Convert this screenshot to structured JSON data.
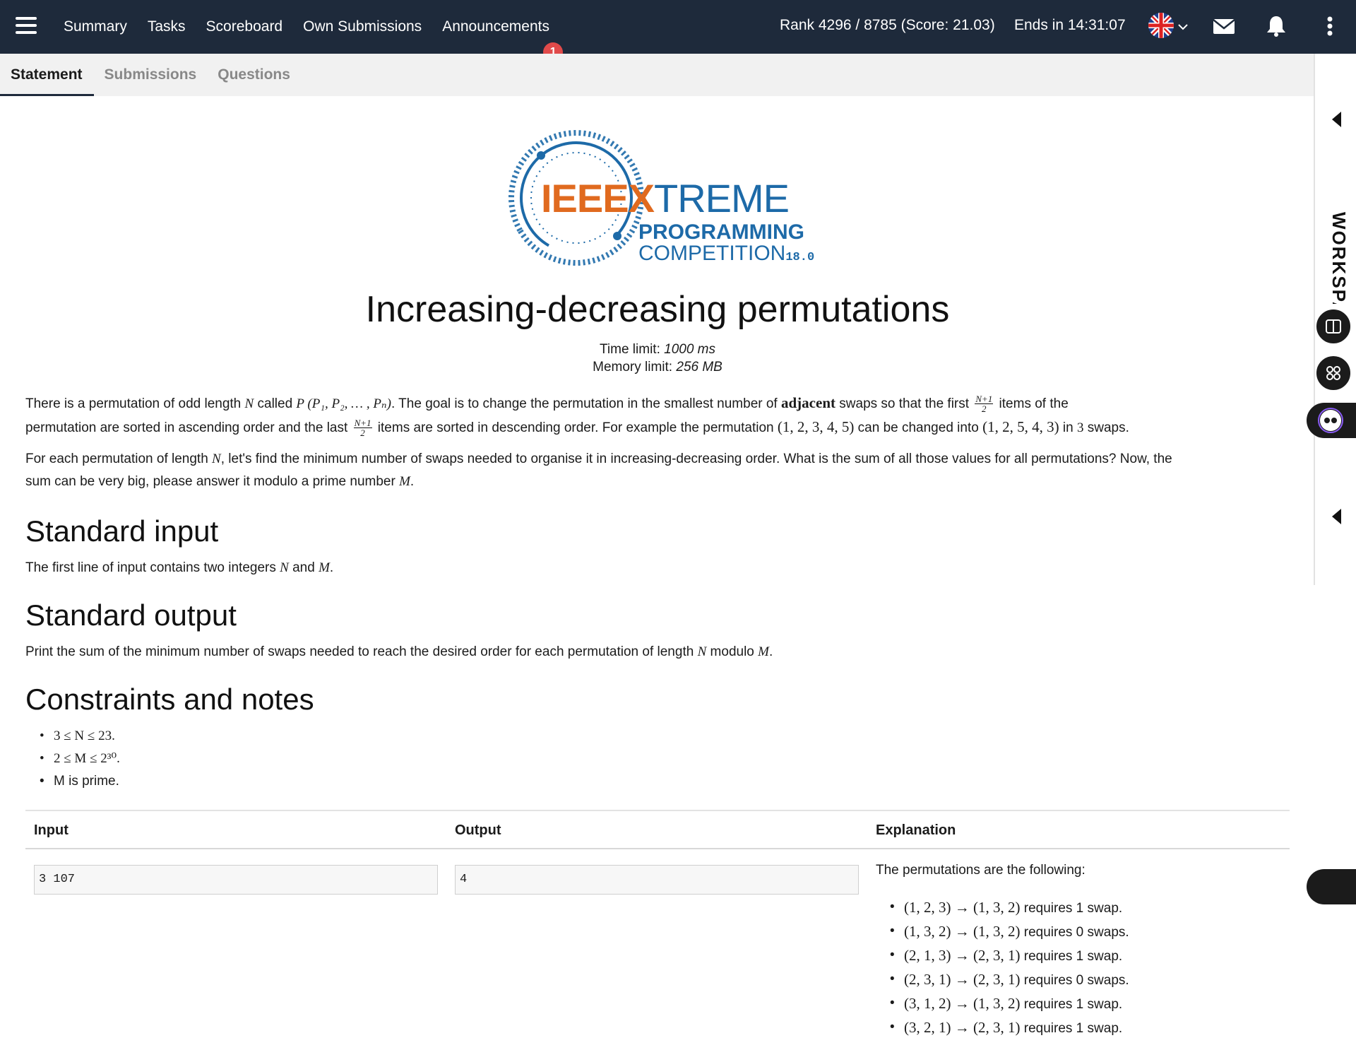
{
  "nav": {
    "items": [
      "Summary",
      "Tasks",
      "Scoreboard",
      "Own Submissions",
      "Announcements"
    ],
    "announcements_badge": "1",
    "rank": "Rank 4296 / 8785 (Score: 21.03)",
    "ends": "Ends in 14:31:07"
  },
  "tabs": [
    "Statement",
    "Submissions",
    "Questions"
  ],
  "sidebar": {
    "workspace_label": "WORKSPA"
  },
  "logo": {
    "ieee": "IEEE",
    "x": "X",
    "treme": "TREME",
    "programming": "PROGRAMMING",
    "competition": "COMPETITION",
    "version": "18.0"
  },
  "problem": {
    "title": "Increasing-decreasing permutations",
    "time_limit_label": "Time limit: ",
    "time_limit": "1000 ms",
    "memory_limit_label": "Memory limit: ",
    "memory_limit": "256 MB",
    "p1_a": "There is a permutation of odd length ",
    "p1_N": "N",
    "p1_b": " called ",
    "p1_P": "P (P₁, P₂, … , Pₙ)",
    "p1_c": ". The goal is to change the permutation in the smallest number of ",
    "p1_adjacent": "adjacent",
    "p1_d": " swaps so that the first ",
    "p1_e": " items of the",
    "p1_f": "permutation are sorted in ascending order and the last ",
    "p1_g": " items are sorted in descending order. For example the permutation ",
    "p1_perm1": "(1, 2, 3, 4, 5)",
    "p1_h": " can be changed into ",
    "p1_perm2": "(1, 2, 5, 4, 3)",
    "p1_i": " in ",
    "p1_three": "3",
    "p1_j": " swaps.",
    "frac_num": "N+1",
    "frac_den": "2",
    "p2_a": "For each permutation of length ",
    "p2_N": "N",
    "p2_b": ", let's find the minimum number of swaps needed to organise it in increasing-decreasing order. What is the sum of all those values for all permutations? Now, the",
    "p2_c": "sum can be very big, please answer it modulo a prime number ",
    "p2_M": "M",
    "p2_d": ".",
    "input_heading": "Standard input",
    "input_a": "The first line of input contains two integers ",
    "input_N": "N",
    "input_and": " and ",
    "input_M": "M",
    "input_dot": ".",
    "output_heading": "Standard output",
    "output_a": "Print the sum of the minimum number of swaps needed to reach the desired order for each permutation of length ",
    "output_N": "N",
    "output_b": " modulo ",
    "output_M": "M",
    "output_dot": ".",
    "constraints_heading": "Constraints and notes",
    "constraints": [
      "3 ≤ N ≤ 23.",
      "2 ≤ M ≤ 2³⁰.",
      "M is prime."
    ]
  },
  "example": {
    "headers": [
      "Input",
      "Output",
      "Explanation"
    ],
    "input": "3 107",
    "output": "4",
    "explanation_intro": "The permutations are the following:",
    "rows": [
      {
        "math": "(1, 2, 3) → (1, 3, 2)",
        "text": " requires 1 swap."
      },
      {
        "math": "(1, 3, 2) → (1, 3, 2)",
        "text": " requires 0 swaps."
      },
      {
        "math": "(2, 1, 3) → (2, 3, 1)",
        "text": " requires 1 swap."
      },
      {
        "math": "(2, 3, 1) → (2, 3, 1)",
        "text": " requires 0 swaps."
      },
      {
        "math": "(3, 1, 2) → (1, 3, 2)",
        "text": " requires 1 swap."
      },
      {
        "math": "(3, 2, 1) → (2, 3, 1)",
        "text": " requires 1 swap."
      }
    ]
  }
}
